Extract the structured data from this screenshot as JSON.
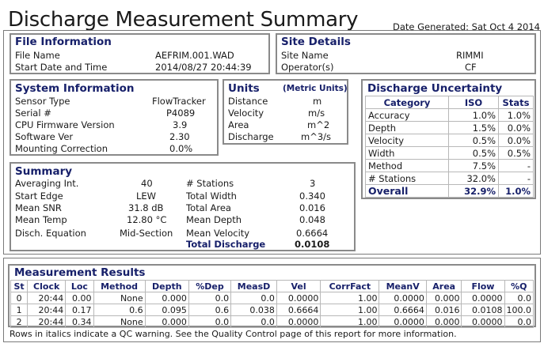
{
  "title": "Discharge Measurement Summary",
  "date_generated": "Date Generated: Sat Oct 4 2014",
  "file_info": {
    "title": "File Information",
    "rows": [
      {
        "label": "File Name",
        "value": "AEFRIM.001.WAD"
      },
      {
        "label": "Start Date and Time",
        "value": "2014/08/27 20:44:39"
      }
    ]
  },
  "site_details": {
    "title": "Site Details",
    "rows": [
      {
        "label": "Site Name",
        "value": "RIMMI"
      },
      {
        "label": "Operator(s)",
        "value": "CF"
      }
    ]
  },
  "system_info": {
    "title": "System Information",
    "rows": [
      {
        "label": "Sensor Type",
        "value": "FlowTracker"
      },
      {
        "label": "Serial #",
        "value": "P4089"
      },
      {
        "label": "CPU Firmware Version",
        "value": "3.9"
      },
      {
        "label": "Software Ver",
        "value": "2.30"
      },
      {
        "label": "Mounting Correction",
        "value": "0.0%"
      }
    ]
  },
  "units": {
    "title": "Units",
    "subtitle": "(Metric Units)",
    "rows": [
      {
        "label": "Distance",
        "value": "m"
      },
      {
        "label": "Velocity",
        "value": "m/s"
      },
      {
        "label": "Area",
        "value": "m^2"
      },
      {
        "label": "Discharge",
        "value": "m^3/s"
      }
    ]
  },
  "uncertainty": {
    "title": "Discharge Uncertainty",
    "headers": [
      "Category",
      "ISO",
      "Stats"
    ],
    "rows": [
      {
        "category": "Accuracy",
        "iso": "1.0%",
        "stats": "1.0%"
      },
      {
        "category": "Depth",
        "iso": "1.5%",
        "stats": "0.0%"
      },
      {
        "category": "Velocity",
        "iso": "0.5%",
        "stats": "0.0%"
      },
      {
        "category": "Width",
        "iso": "0.5%",
        "stats": "0.5%"
      },
      {
        "category": "Method",
        "iso": "7.5%",
        "stats": "-"
      },
      {
        "category": "# Stations",
        "iso": "32.0%",
        "stats": "-"
      }
    ],
    "overall": {
      "category": "Overall",
      "iso": "32.9%",
      "stats": "1.0%"
    }
  },
  "summary": {
    "title": "Summary",
    "left": [
      {
        "label": "Averaging Int.",
        "value": "40"
      },
      {
        "label": "Start Edge",
        "value": "LEW"
      },
      {
        "label": "Mean SNR",
        "value": "31.8 dB"
      },
      {
        "label": "Mean Temp",
        "value": "12.80 °C"
      },
      {
        "label": "Disch. Equation",
        "value": "Mid-Section"
      }
    ],
    "right": [
      {
        "label": "# Stations",
        "value": "3"
      },
      {
        "label": "Total Width",
        "value": "0.340"
      },
      {
        "label": "Total Area",
        "value": "0.016"
      },
      {
        "label": "Mean Depth",
        "value": "0.048"
      },
      {
        "label": "Mean Velocity",
        "value": "0.6664"
      },
      {
        "label": "Total Discharge",
        "value": "0.0108"
      }
    ]
  },
  "results": {
    "title": "Measurement Results",
    "headers": [
      "St",
      "Clock",
      "Loc",
      "Method",
      "Depth",
      "%Dep",
      "MeasD",
      "Vel",
      "CorrFact",
      "MeanV",
      "Area",
      "Flow",
      "%Q"
    ],
    "rows": [
      [
        "0",
        "20:44",
        "0.00",
        "None",
        "0.000",
        "0.0",
        "0.0",
        "0.0000",
        "1.00",
        "0.0000",
        "0.000",
        "0.0000",
        "0.0"
      ],
      [
        "1",
        "20:44",
        "0.17",
        "0.6",
        "0.095",
        "0.6",
        "0.038",
        "0.6664",
        "1.00",
        "0.6664",
        "0.016",
        "0.0108",
        "100.0"
      ],
      [
        "2",
        "20:44",
        "0.34",
        "None",
        "0.000",
        "0.0",
        "0.0",
        "0.0000",
        "1.00",
        "0.0000",
        "0.000",
        "0.0000",
        "0.0"
      ]
    ]
  },
  "footnote": "Rows in italics indicate a QC warning. See the Quality Control page of this report for more information."
}
